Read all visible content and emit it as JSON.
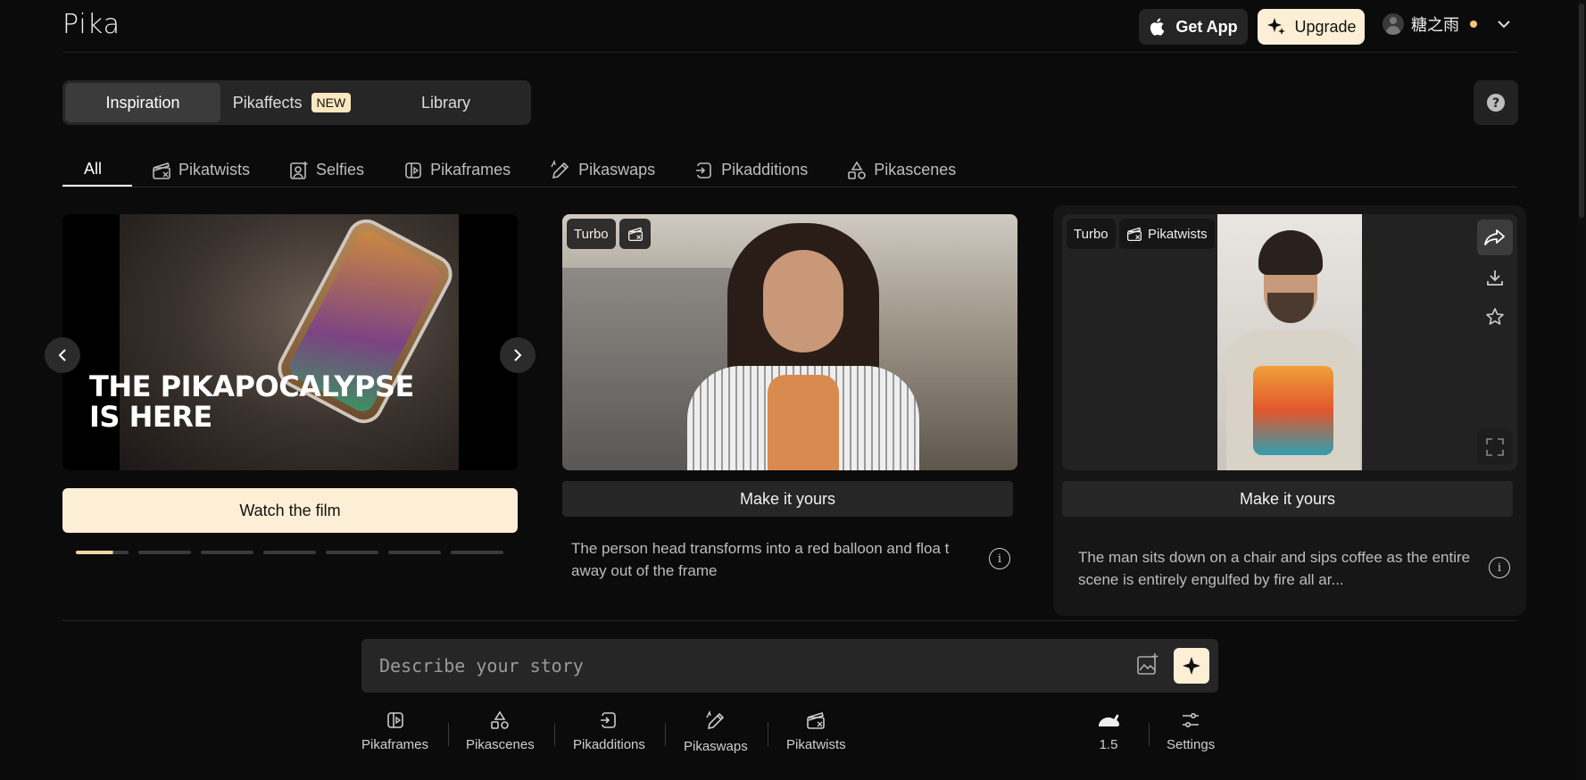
{
  "app": {
    "logo": "Pika"
  },
  "header": {
    "get_app": "Get App",
    "upgrade": "Upgrade",
    "username": "糖之雨"
  },
  "segments": [
    {
      "label": "Inspiration",
      "active": true
    },
    {
      "label": "Pikaffects",
      "badge": "NEW"
    },
    {
      "label": "Library"
    }
  ],
  "filter_tabs": [
    {
      "label": "All",
      "active": true
    },
    {
      "label": "Pikatwists",
      "icon": "clapper-icon"
    },
    {
      "label": "Selfies",
      "icon": "selfie-icon"
    },
    {
      "label": "Pikaframes",
      "icon": "frames-icon"
    },
    {
      "label": "Pikaswaps",
      "icon": "swap-brush-icon"
    },
    {
      "label": "Pikadditions",
      "icon": "addition-icon"
    },
    {
      "label": "Pikascenes",
      "icon": "shapes-icon"
    }
  ],
  "hero": {
    "title_line1": "THE PIKAPOCALYPSE",
    "title_line2": "IS HERE",
    "cta": "Watch the film",
    "slides_total": 7,
    "active_slide": 1
  },
  "cards": [
    {
      "badges": [
        "Turbo"
      ],
      "cta": "Make it yours",
      "description": "The person head transforms into a red balloon and floa t away out of the frame"
    },
    {
      "badges": [
        "Turbo",
        "Pikatwists"
      ],
      "cta": "Make it yours",
      "description": "The man sits down on a chair and sips coffee as the entire scene is entirely engulfed by fire all ar..."
    }
  ],
  "prompt": {
    "placeholder": "Describe your story"
  },
  "tools": [
    {
      "label": "Pikaframes",
      "icon": "frames-icon"
    },
    {
      "label": "Pikascenes",
      "icon": "shapes-icon"
    },
    {
      "label": "Pikadditions",
      "icon": "addition-icon"
    },
    {
      "label": "Pikaswaps",
      "icon": "swap-brush-icon"
    },
    {
      "label": "Pikatwists",
      "icon": "clapper-icon"
    }
  ],
  "model": {
    "version": "1.5",
    "icon": "rabbit-icon"
  },
  "settings": {
    "label": "Settings"
  },
  "colors": {
    "accent": "#fdeed6",
    "background": "#0b0b0b",
    "badge_new": "#fbe7c0",
    "status_dot": "#f5c67a"
  }
}
